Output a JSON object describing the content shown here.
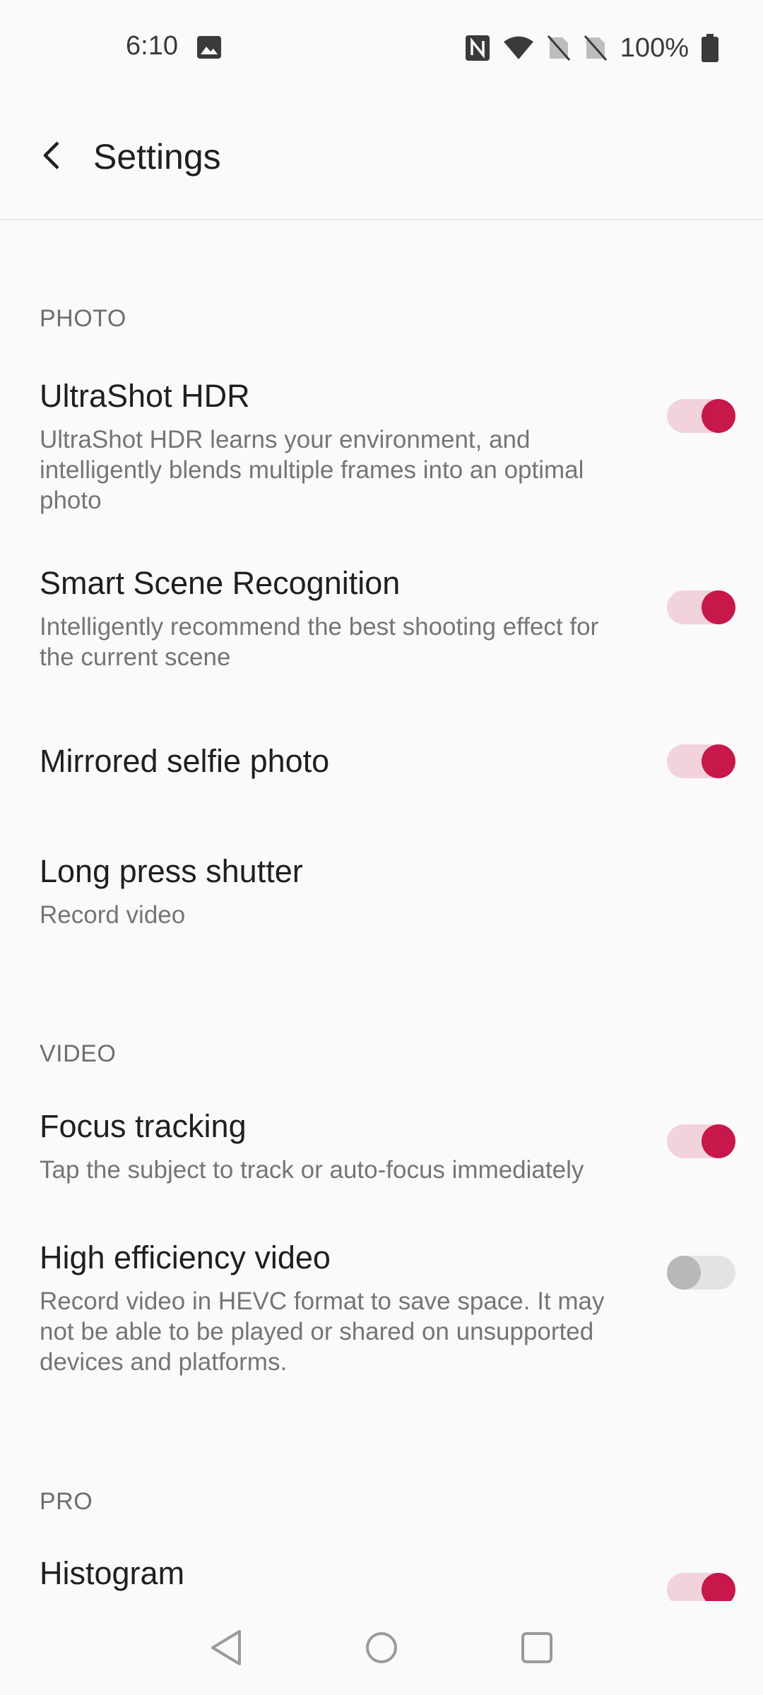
{
  "status_bar": {
    "time": "6:10",
    "battery_percent": "100%",
    "icons": [
      "image-icon",
      "nfc-icon",
      "wifi-icon",
      "no-sim-icon",
      "no-sim-icon",
      "battery-icon"
    ]
  },
  "app_bar": {
    "title": "Settings",
    "back_icon": "back-arrow-icon"
  },
  "sections": {
    "photo": {
      "header": "PHOTO",
      "items": [
        {
          "title": "UltraShot HDR",
          "description": "UltraShot HDR learns your environment, and intelligently blends multiple frames into an optimal photo",
          "toggle": "on"
        },
        {
          "title": "Smart Scene Recognition",
          "description": "Intelligently recommend the best shooting effect for the current scene",
          "toggle": "on"
        },
        {
          "title": "Mirrored selfie photo",
          "toggle": "on"
        },
        {
          "title": "Long press shutter",
          "description": "Record video"
        }
      ]
    },
    "video": {
      "header": "VIDEO",
      "items": [
        {
          "title": "Focus tracking",
          "description": "Tap the subject to track or auto-focus immediately",
          "toggle": "on"
        },
        {
          "title": "High efficiency video",
          "description": "Record video in HEVC format to save space. It may not be able to be played or shared on unsupported devices and platforms.",
          "toggle": "off"
        }
      ]
    },
    "pro": {
      "header": "PRO",
      "items": [
        {
          "title": "Histogram",
          "toggle": "on"
        }
      ]
    }
  },
  "colors": {
    "accent": "#c8174a",
    "accent_track": "#f2d3dc",
    "background": "#fafafa",
    "text_primary": "#1f1f1f",
    "text_secondary": "#757575"
  },
  "nav_bar": {
    "icons": [
      "back-triangle-icon",
      "home-circle-icon",
      "recents-square-icon"
    ]
  }
}
